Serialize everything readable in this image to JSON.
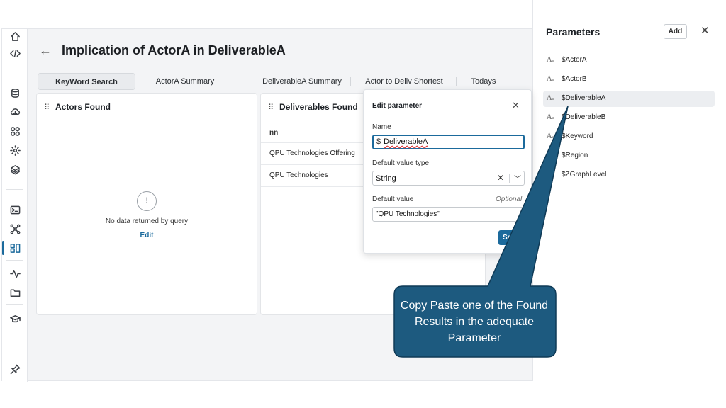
{
  "page": {
    "title": "Implication of ActorA in DeliverableA"
  },
  "rail": {
    "icons": [
      "home-icon",
      "code-icon",
      "database-icon",
      "cloud-download-icon",
      "apps-icon",
      "selection-icon",
      "layers-icon",
      "terminal-icon",
      "graph-icon",
      "dashboard-icon",
      "activity-icon",
      "folder-icon",
      "learn-icon",
      "pin-icon"
    ],
    "accent": "#1b6a9c"
  },
  "tabs": [
    {
      "label": "KeyWord Search",
      "active": true
    },
    {
      "label": "ActorA Summary",
      "active": false
    },
    {
      "label": "DeliverableA Summary",
      "active": false
    },
    {
      "label": "Actor to Deliv Shortest",
      "active": false
    },
    {
      "label": "Todays",
      "active": false
    }
  ],
  "actors_card": {
    "title": "Actors Found",
    "empty_icon": "!",
    "empty_text": "No data returned by query",
    "edit_label": "Edit"
  },
  "deliverables_card": {
    "title": "Deliverables Found",
    "column_header": "nn",
    "rows": [
      "QPU Technologies Offering",
      "QPU Technologies"
    ]
  },
  "parameters_panel": {
    "title": "Parameters",
    "add_label": "Add",
    "close_glyph": "✕",
    "items": [
      {
        "name": "$ActorA",
        "selected": false
      },
      {
        "name": "$ActorB",
        "selected": false
      },
      {
        "name": "$DeliverableA",
        "selected": true
      },
      {
        "name": "$DeliverableB",
        "selected": false
      },
      {
        "name": "$Keyword",
        "selected": false
      },
      {
        "name": "$Region",
        "selected": false
      },
      {
        "name": "$ZGraphLevel",
        "selected": false
      }
    ]
  },
  "editor": {
    "title": "Edit parameter",
    "close_glyph": "✕",
    "name_label": "Name",
    "name_prefix": "$",
    "name_value": "DeliverableA",
    "type_label": "Default value type",
    "type_value": "String",
    "default_label": "Default value",
    "optional_label": "Optional",
    "default_value": "\"QPU Technologies\"",
    "save_label": "Save"
  },
  "callout": {
    "text": "Copy Paste one of the Found Results in the adequate Parameter",
    "fill": "#1d5a7f",
    "stroke": "#0f3a56"
  }
}
